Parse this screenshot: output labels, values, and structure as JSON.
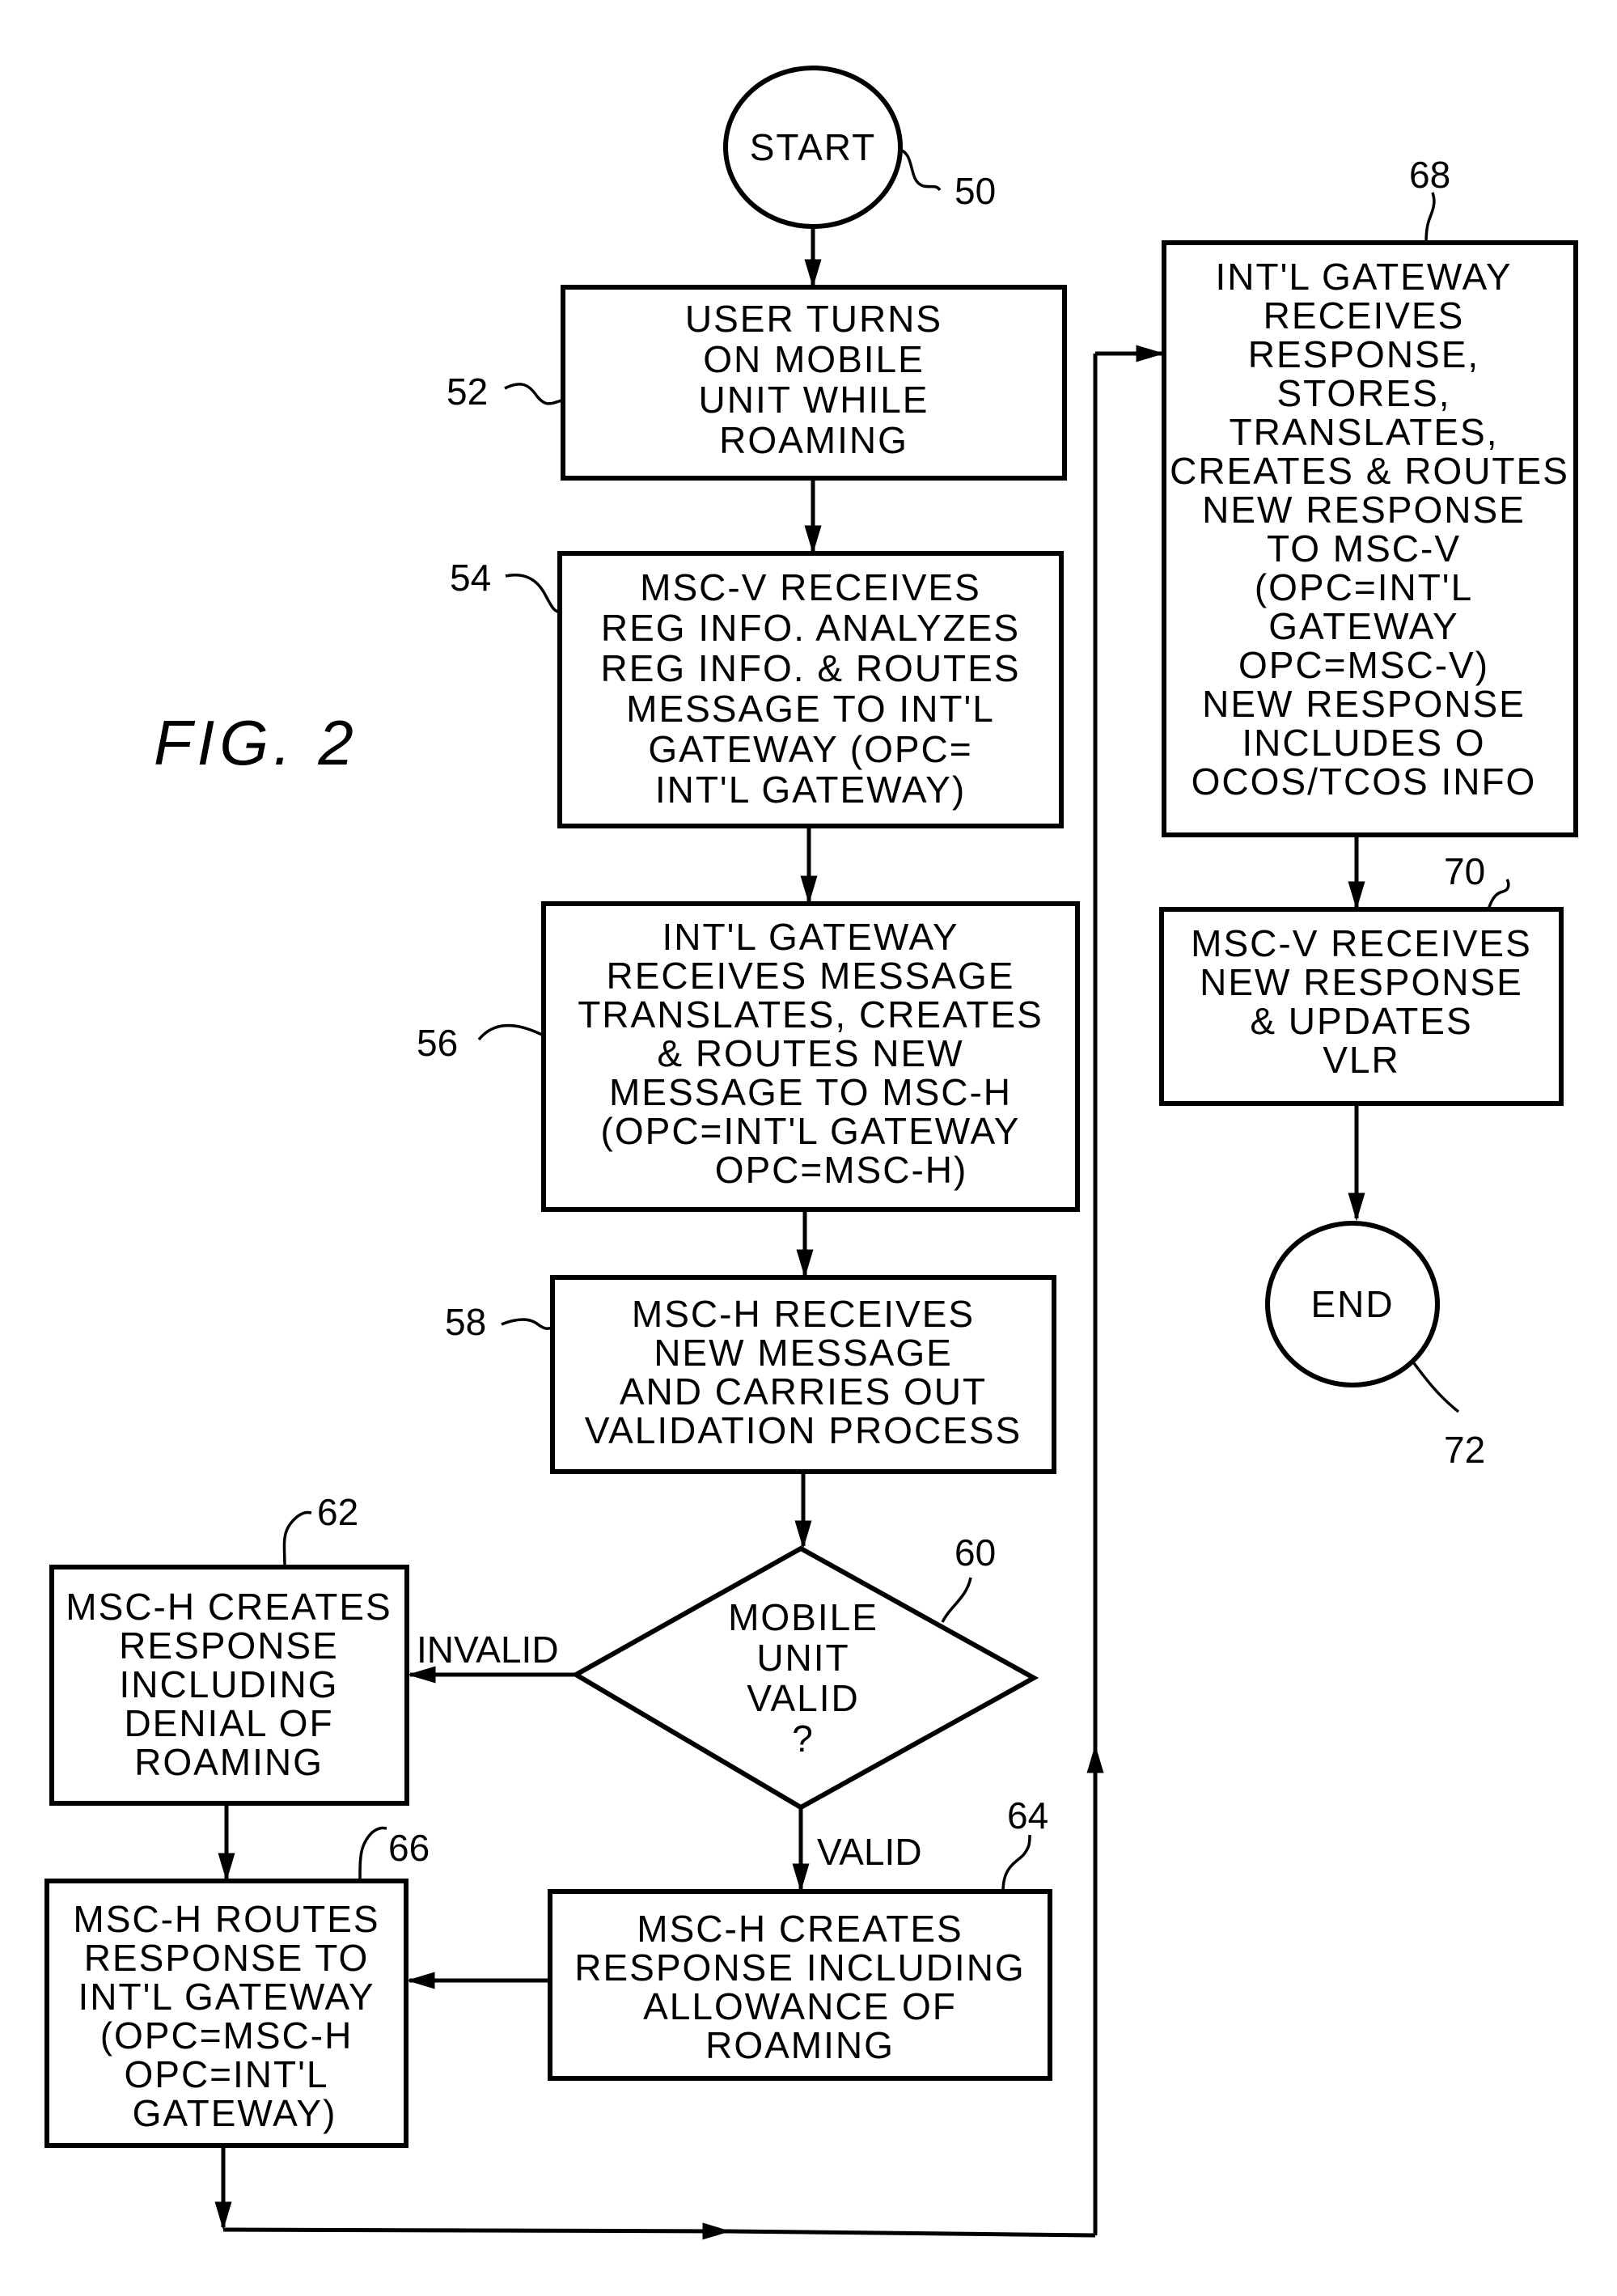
{
  "figure_label": "FIG. 2",
  "nodes": {
    "start": {
      "ref": "50",
      "lines": [
        "START"
      ]
    },
    "n52": {
      "ref": "52",
      "lines": [
        "USER TURNS",
        "ON MOBILE",
        "UNIT WHILE",
        "ROAMING"
      ]
    },
    "n54": {
      "ref": "54",
      "lines": [
        "MSC-V RECEIVES",
        "REG INFO. ANALYZES",
        "REG INFO. & ROUTES",
        "MESSAGE TO INT'L",
        "GATEWAY (OPC=",
        "INT'L GATEWAY)"
      ]
    },
    "n56": {
      "ref": "56",
      "lines": [
        "INT'L GATEWAY",
        "RECEIVES MESSAGE",
        "TRANSLATES, CREATES",
        "& ROUTES NEW",
        "MESSAGE TO MSC-H",
        "(OPC=INT'L GATEWAY",
        "OPC=MSC-H)"
      ]
    },
    "n58": {
      "ref": "58",
      "lines": [
        "MSC-H RECEIVES",
        "NEW MESSAGE",
        "AND CARRIES OUT",
        "VALIDATION PROCESS"
      ]
    },
    "n60": {
      "ref": "60",
      "lines": [
        "MOBILE",
        "UNIT",
        "VALID",
        "?"
      ]
    },
    "n62": {
      "ref": "62",
      "lines": [
        "MSC-H CREATES",
        "RESPONSE",
        "INCLUDING",
        "DENIAL OF",
        "ROAMING"
      ]
    },
    "n64": {
      "ref": "64",
      "lines": [
        "MSC-H CREATES",
        "RESPONSE INCLUDING",
        "ALLOWANCE OF",
        "ROAMING"
      ]
    },
    "n66": {
      "ref": "66",
      "lines": [
        "MSC-H ROUTES",
        "RESPONSE TO",
        "INT'L GATEWAY",
        "(OPC=MSC-H",
        "OPC=INT'L",
        "GATEWAY)"
      ]
    },
    "n68": {
      "ref": "68",
      "lines": [
        "INT'L GATEWAY",
        "RECEIVES",
        "RESPONSE,",
        "STORES,",
        "TRANSLATES,",
        "CREATES & ROUTES",
        "NEW RESPONSE",
        "TO MSC-V",
        "(OPC=INT'L",
        "GATEWAY",
        "OPC=MSC-V)",
        "NEW RESPONSE",
        "INCLUDES O",
        "OCOS/TCOS INFO"
      ]
    },
    "n70": {
      "ref": "70",
      "lines": [
        "MSC-V RECEIVES",
        "NEW RESPONSE",
        "& UPDATES",
        "VLR"
      ]
    },
    "end": {
      "ref": "72",
      "lines": [
        "END"
      ]
    }
  },
  "edge_labels": {
    "invalid": "INVALID",
    "valid": "VALID"
  }
}
